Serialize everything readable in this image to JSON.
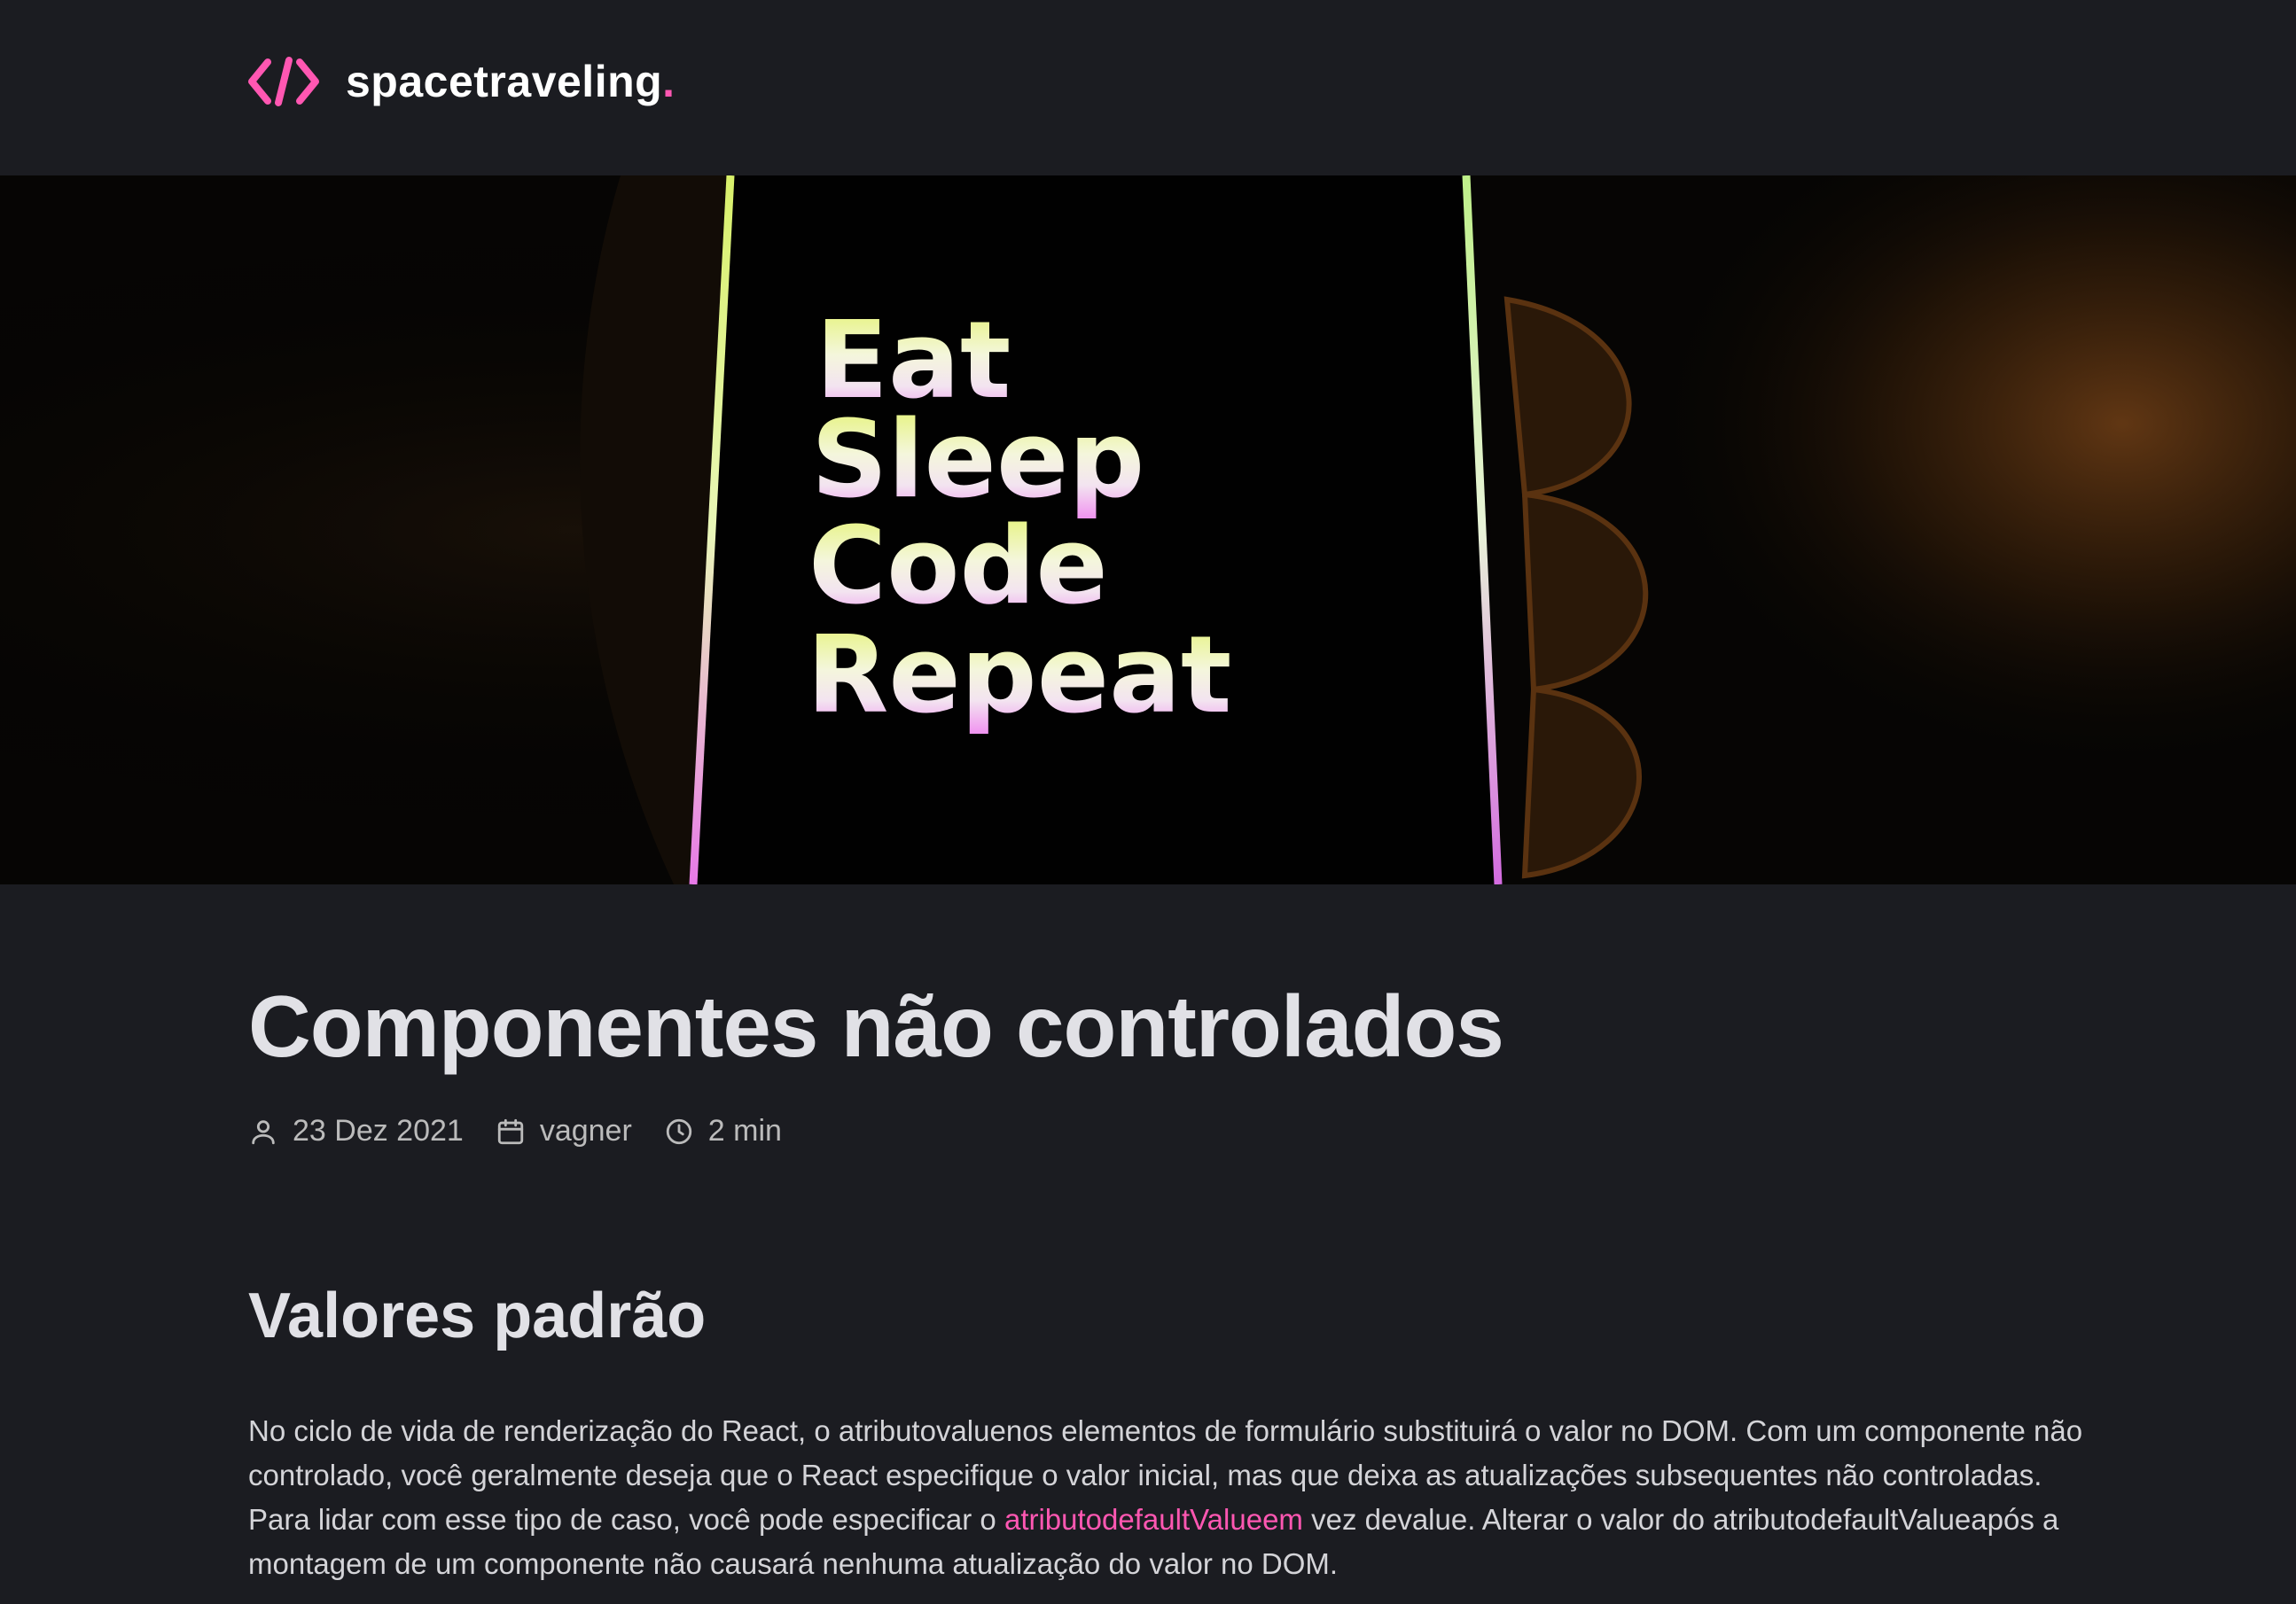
{
  "header": {
    "brand": "spacetraveling",
    "brand_dot": ".",
    "logo_icon": "code-brackets-icon",
    "accent_color": "#ff57b2"
  },
  "banner": {
    "image": "phone-screen-banner",
    "lines": [
      "Eat",
      "Sleep",
      "Code",
      "Repeat"
    ]
  },
  "post": {
    "title": "Componentes não controlados",
    "meta": {
      "date": "23 Dez 2021",
      "date_icon": "user-icon",
      "author": "vagner",
      "author_icon": "calendar-icon",
      "reading_time": "2 min",
      "reading_time_icon": "clock-icon"
    },
    "sections": [
      {
        "heading": "Valores padrão",
        "paragraph": {
          "text_before": "No ciclo de vida de renderização do React, o atributovaluenos elementos de formulário substituirá o valor no DOM. Com um componente não controlado, você geralmente deseja que o React especifique o valor inicial, mas que deixa as atualizações subsequentes não controladas. Para lidar com esse tipo de caso, você pode especificar o ",
          "link_text": "atributodefaultValueem",
          "text_after": " vez devalue. Alterar o valor do atributodefaultValueapós a montagem de um componente não causará nenhuma atualização do valor no DOM."
        }
      }
    ]
  }
}
